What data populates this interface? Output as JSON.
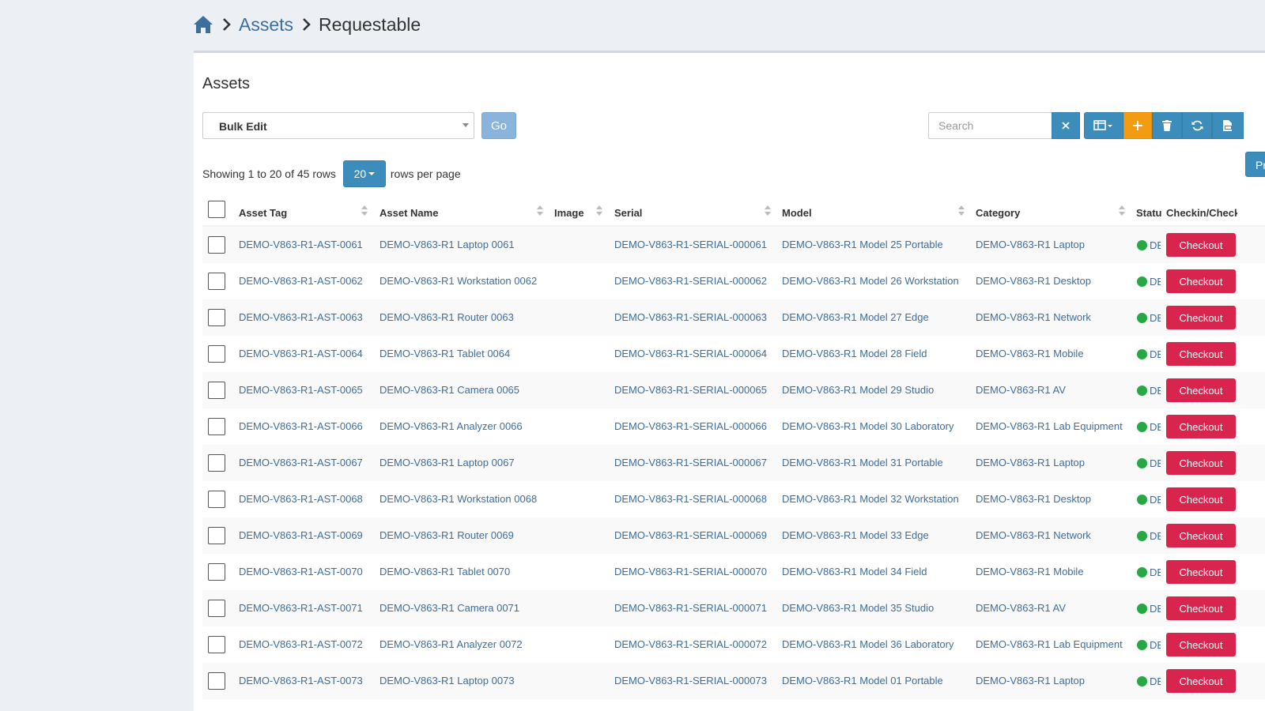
{
  "breadcrumb": {
    "assets": "Assets",
    "current": "Requestable"
  },
  "box": {
    "title": "Assets"
  },
  "toolbar": {
    "bulk_edit": "Bulk Edit",
    "go": "Go",
    "search_placeholder": "Search",
    "pr_label": "Pr"
  },
  "pagination": {
    "showing": "Showing 1 to 20 of 45 rows",
    "per_page": "20",
    "rows_per_page": "rows per page"
  },
  "columns": {
    "asset_tag": "Asset Tag",
    "asset_name": "Asset Name",
    "image": "Image",
    "serial": "Serial",
    "model": "Model",
    "category": "Category",
    "status": "Statu",
    "checkin": "Checkin/Checkout"
  },
  "rows": [
    {
      "tag": "DEMO-V863-R1-AST-0061",
      "name": "DEMO-V863-R1 Laptop 0061",
      "serial": "DEMO-V863-R1-SERIAL-000061",
      "model": "DEMO-V863-R1 Model 25 Portable",
      "category": "DEMO-V863-R1 Laptop",
      "status": "DE",
      "action": "Checkout"
    },
    {
      "tag": "DEMO-V863-R1-AST-0062",
      "name": "DEMO-V863-R1 Workstation 0062",
      "serial": "DEMO-V863-R1-SERIAL-000062",
      "model": "DEMO-V863-R1 Model 26 Workstation",
      "category": "DEMO-V863-R1 Desktop",
      "status": "DE",
      "action": "Checkout"
    },
    {
      "tag": "DEMO-V863-R1-AST-0063",
      "name": "DEMO-V863-R1 Router 0063",
      "serial": "DEMO-V863-R1-SERIAL-000063",
      "model": "DEMO-V863-R1 Model 27 Edge",
      "category": "DEMO-V863-R1 Network",
      "status": "DE",
      "action": "Checkout"
    },
    {
      "tag": "DEMO-V863-R1-AST-0064",
      "name": "DEMO-V863-R1 Tablet 0064",
      "serial": "DEMO-V863-R1-SERIAL-000064",
      "model": "DEMO-V863-R1 Model 28 Field",
      "category": "DEMO-V863-R1 Mobile",
      "status": "DE",
      "action": "Checkout"
    },
    {
      "tag": "DEMO-V863-R1-AST-0065",
      "name": "DEMO-V863-R1 Camera 0065",
      "serial": "DEMO-V863-R1-SERIAL-000065",
      "model": "DEMO-V863-R1 Model 29 Studio",
      "category": "DEMO-V863-R1 AV",
      "status": "DE",
      "action": "Checkout"
    },
    {
      "tag": "DEMO-V863-R1-AST-0066",
      "name": "DEMO-V863-R1 Analyzer 0066",
      "serial": "DEMO-V863-R1-SERIAL-000066",
      "model": "DEMO-V863-R1 Model 30 Laboratory",
      "category": "DEMO-V863-R1 Lab Equipment",
      "status": "DE",
      "action": "Checkout"
    },
    {
      "tag": "DEMO-V863-R1-AST-0067",
      "name": "DEMO-V863-R1 Laptop 0067",
      "serial": "DEMO-V863-R1-SERIAL-000067",
      "model": "DEMO-V863-R1 Model 31 Portable",
      "category": "DEMO-V863-R1 Laptop",
      "status": "DE",
      "action": "Checkout"
    },
    {
      "tag": "DEMO-V863-R1-AST-0068",
      "name": "DEMO-V863-R1 Workstation 0068",
      "serial": "DEMO-V863-R1-SERIAL-000068",
      "model": "DEMO-V863-R1 Model 32 Workstation",
      "category": "DEMO-V863-R1 Desktop",
      "status": "DE",
      "action": "Checkout"
    },
    {
      "tag": "DEMO-V863-R1-AST-0069",
      "name": "DEMO-V863-R1 Router 0069",
      "serial": "DEMO-V863-R1-SERIAL-000069",
      "model": "DEMO-V863-R1 Model 33 Edge",
      "category": "DEMO-V863-R1 Network",
      "status": "DE",
      "action": "Checkout"
    },
    {
      "tag": "DEMO-V863-R1-AST-0070",
      "name": "DEMO-V863-R1 Tablet 0070",
      "serial": "DEMO-V863-R1-SERIAL-000070",
      "model": "DEMO-V863-R1 Model 34 Field",
      "category": "DEMO-V863-R1 Mobile",
      "status": "DE",
      "action": "Checkout"
    },
    {
      "tag": "DEMO-V863-R1-AST-0071",
      "name": "DEMO-V863-R1 Camera 0071",
      "serial": "DEMO-V863-R1-SERIAL-000071",
      "model": "DEMO-V863-R1 Model 35 Studio",
      "category": "DEMO-V863-R1 AV",
      "status": "DE",
      "action": "Checkout"
    },
    {
      "tag": "DEMO-V863-R1-AST-0072",
      "name": "DEMO-V863-R1 Analyzer 0072",
      "serial": "DEMO-V863-R1-SERIAL-000072",
      "model": "DEMO-V863-R1 Model 36 Laboratory",
      "category": "DEMO-V863-R1 Lab Equipment",
      "status": "DE",
      "action": "Checkout"
    },
    {
      "tag": "DEMO-V863-R1-AST-0073",
      "name": "DEMO-V863-R1 Laptop 0073",
      "serial": "DEMO-V863-R1-SERIAL-000073",
      "model": "DEMO-V863-R1 Model 01 Portable",
      "category": "DEMO-V863-R1 Laptop",
      "status": "DE",
      "action": "Checkout"
    }
  ]
}
